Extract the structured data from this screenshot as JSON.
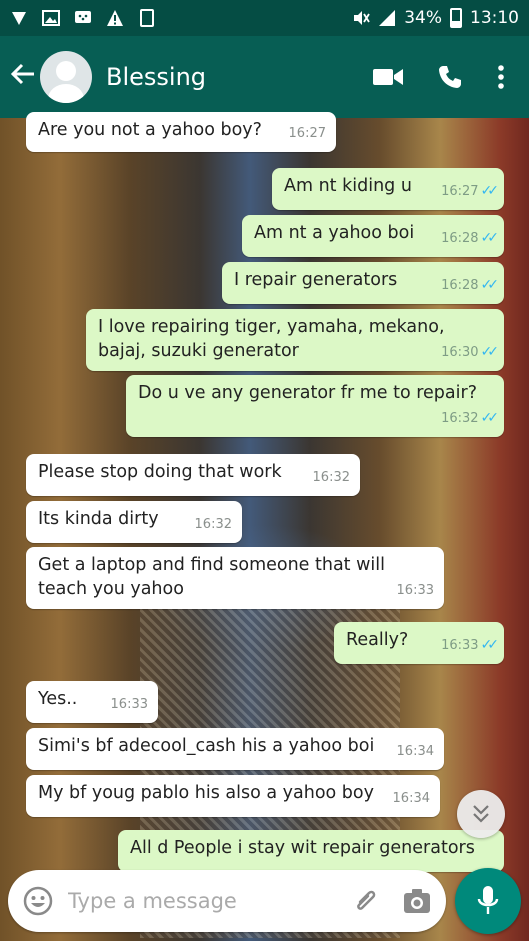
{
  "status_bar": {
    "battery": "34%",
    "time": "13:10"
  },
  "header": {
    "contact_name": "Blessing"
  },
  "messages": [
    {
      "direction": "in",
      "text": "Are you not a yahoo boy?",
      "time": "16:27"
    },
    {
      "direction": "out",
      "text": "Am nt kiding u",
      "time": "16:27",
      "read": true
    },
    {
      "direction": "out",
      "text": "Am nt a yahoo boi",
      "time": "16:28",
      "read": true
    },
    {
      "direction": "out",
      "text": "I repair generators",
      "time": "16:28",
      "read": true
    },
    {
      "direction": "out",
      "text": "I love repairing tiger, yamaha, mekano, bajaj, suzuki generator",
      "time": "16:30",
      "read": true
    },
    {
      "direction": "out",
      "text": "Do u ve any generator fr me to repair?",
      "time": "16:32",
      "read": true
    },
    {
      "direction": "in",
      "text": "Please stop doing that work",
      "time": "16:32"
    },
    {
      "direction": "in",
      "text": "Its kinda dirty",
      "time": "16:32"
    },
    {
      "direction": "in",
      "text": "Get a laptop and find someone that will teach you yahoo",
      "time": "16:33"
    },
    {
      "direction": "out",
      "text": "Really?",
      "time": "16:33",
      "read": true
    },
    {
      "direction": "in",
      "text": "Yes..",
      "time": "16:33"
    },
    {
      "direction": "in",
      "text": "Simi's bf adecool_cash his a yahoo boi",
      "time": "16:34"
    },
    {
      "direction": "in",
      "text": "My bf youg pablo his also a yahoo boy",
      "time": "16:34"
    },
    {
      "direction": "out",
      "text": "All d People i stay wit repair generators",
      "time": ""
    }
  ],
  "composer": {
    "placeholder": "Type a message"
  },
  "colors": {
    "header": "#075e54",
    "status": "#054d44",
    "outgoing": "#dcf8c6",
    "incoming": "#ffffff",
    "tick": "#34b7f1",
    "mic": "#00897b"
  }
}
